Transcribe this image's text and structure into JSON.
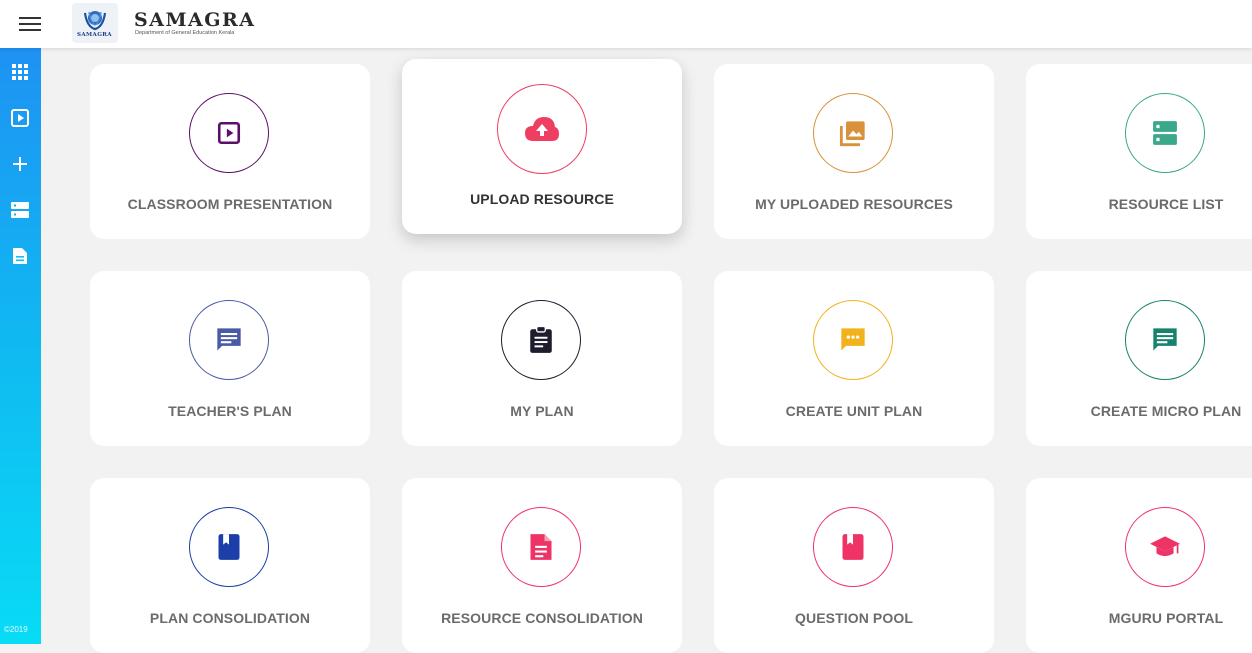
{
  "header": {
    "brand_name": "SAMAGRA",
    "brand_subtitle": "Department of General Education Kerala",
    "logo_text": "SAMAGRA"
  },
  "sidebar": {
    "items": [
      {
        "icon": "apps-grid-icon"
      },
      {
        "icon": "presentation-icon"
      },
      {
        "icon": "plus-icon"
      },
      {
        "icon": "resource-list-icon"
      },
      {
        "icon": "document-icon"
      }
    ],
    "copyright": "©2019"
  },
  "cards": [
    {
      "label": "CLASSROOM PRESENTATION",
      "icon": "play-box-icon",
      "color": "#5c0f6a"
    },
    {
      "label": "UPLOAD RESOURCE",
      "icon": "cloud-upload-icon",
      "color": "#ee3f63"
    },
    {
      "label": "MY UPLOADED RESOURCES",
      "icon": "image-library-icon",
      "color": "#d9913b"
    },
    {
      "label": "RESOURCE LIST",
      "icon": "server-list-icon",
      "color": "#3aa88a"
    },
    {
      "label": "TEACHER'S PLAN",
      "icon": "chat-lines-icon",
      "color": "#4a5aa5"
    },
    {
      "label": "MY PLAN",
      "icon": "clipboard-icon",
      "color": "#1d1d2e"
    },
    {
      "label": "CREATE UNIT PLAN",
      "icon": "chat-dots-icon",
      "color": "#f2b21c"
    },
    {
      "label": "CREATE MICRO PLAN",
      "icon": "chat-lines-icon",
      "color": "#16826d"
    },
    {
      "label": "PLAN CONSOLIDATION",
      "icon": "book-icon",
      "color": "#1b3ea8"
    },
    {
      "label": "RESOURCE CONSOLIDATION",
      "icon": "file-text-icon",
      "color": "#ee3467"
    },
    {
      "label": "QUESTION POOL",
      "icon": "bookmark-book-icon",
      "color": "#ee3467"
    },
    {
      "label": "MGURU PORTAL",
      "icon": "graduation-cap-icon",
      "color": "#ee3467"
    }
  ]
}
